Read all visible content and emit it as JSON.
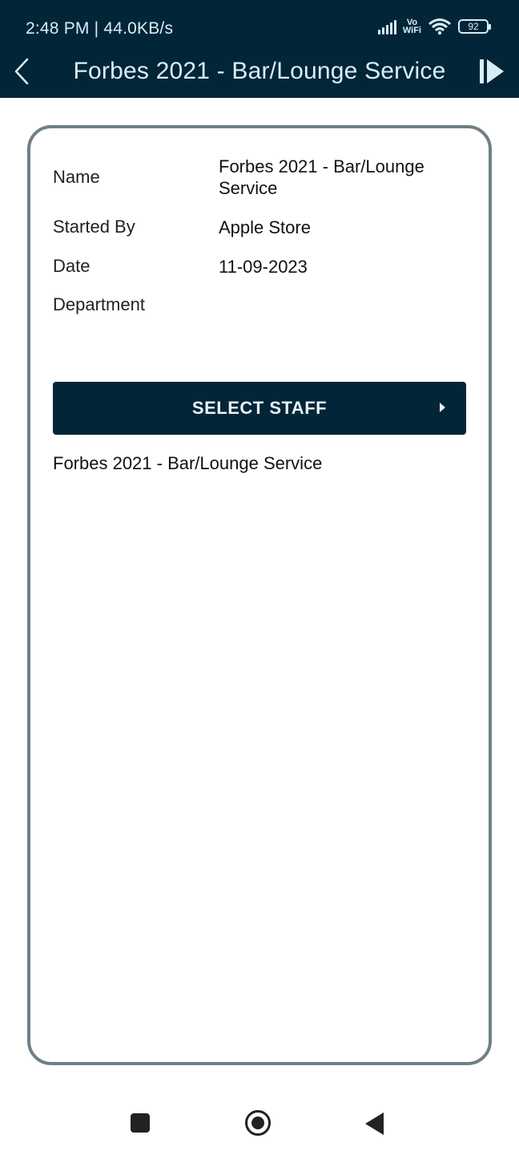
{
  "status": {
    "time_speed": "2:48 PM | 44.0KB/s",
    "vowifi_top": "Vo",
    "vowifi_bottom": "WiFi",
    "battery": "92"
  },
  "app_bar": {
    "title": "Forbes 2021 - Bar/Lounge Service",
    "back_icon": "chevron-left-icon",
    "next_icon": "skip-next-icon"
  },
  "details": {
    "name_label": "Name",
    "name_value": "Forbes 2021 - Bar/Lounge Service",
    "started_by_label": "Started By",
    "started_by_value": "Apple Store",
    "date_label": "Date",
    "date_value": "11-09-2023",
    "department_label": "Department",
    "department_value": ""
  },
  "select_staff": {
    "label": "SELECT STAFF"
  },
  "staff_list": [
    "Forbes 2021 - Bar/Lounge Service"
  ],
  "colors": {
    "primary": "#032538",
    "on_primary": "#d8eef5",
    "card_border": "#6e8086"
  }
}
